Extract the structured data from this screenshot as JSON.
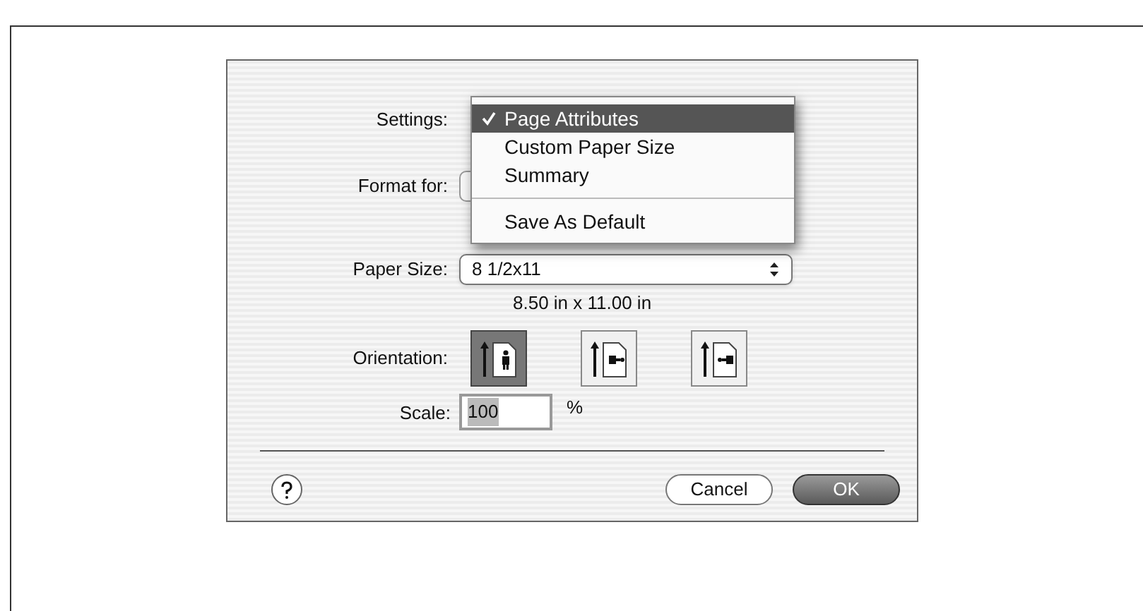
{
  "settings": {
    "label": "Settings:",
    "menu": [
      {
        "label": "Page Attributes",
        "selected": true
      },
      {
        "label": "Custom Paper Size",
        "selected": false
      },
      {
        "label": "Summary",
        "selected": false
      },
      {
        "kind": "separator"
      },
      {
        "label": "Save As Default",
        "selected": false
      }
    ]
  },
  "format_for": {
    "label": "Format for:"
  },
  "paper_size": {
    "label": "Paper Size:",
    "value": "8 1/2x11",
    "dimensions": "8.50 in x 11.00 in"
  },
  "orientation": {
    "label": "Orientation:",
    "options": [
      {
        "kind": "portrait",
        "selected": true
      },
      {
        "kind": "landscape",
        "selected": false
      },
      {
        "kind": "reverse-landscape",
        "selected": false
      }
    ]
  },
  "scale": {
    "label": "Scale:",
    "value": "100",
    "unit": "%"
  },
  "buttons": [
    {
      "label": "Cancel",
      "default": false
    },
    {
      "label": "OK",
      "default": true
    }
  ]
}
